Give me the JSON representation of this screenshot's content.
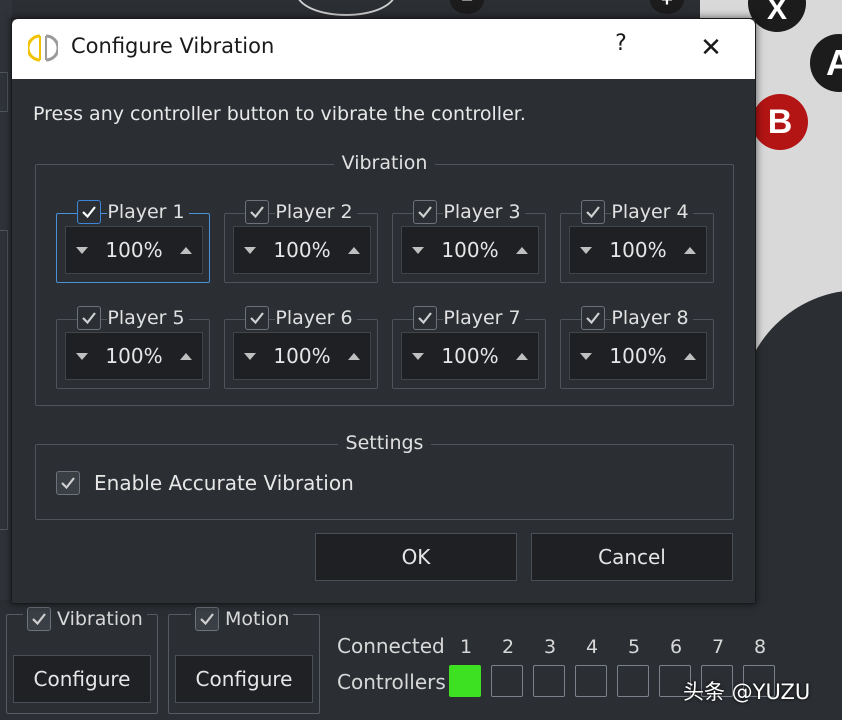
{
  "dialog": {
    "title": "Configure Vibration",
    "help_glyph": "?",
    "close_glyph": "✕",
    "instruction": "Press any controller button to vibrate the controller.",
    "vibration_group_title": "Vibration",
    "players": [
      {
        "label": "Player 1",
        "value": "100%"
      },
      {
        "label": "Player 2",
        "value": "100%"
      },
      {
        "label": "Player 3",
        "value": "100%"
      },
      {
        "label": "Player 4",
        "value": "100%"
      },
      {
        "label": "Player 5",
        "value": "100%"
      },
      {
        "label": "Player 6",
        "value": "100%"
      },
      {
        "label": "Player 7",
        "value": "100%"
      },
      {
        "label": "Player 8",
        "value": "100%"
      }
    ],
    "settings_group_title": "Settings",
    "accurate_vibration_label": "Enable Accurate Vibration",
    "ok_label": "OK",
    "cancel_label": "Cancel"
  },
  "background": {
    "buttons": {
      "x": "X",
      "a": "A",
      "b": "B",
      "minus": "−",
      "plus": "+"
    },
    "vibration_label": "Vibration",
    "vibration_configure": "Configure",
    "motion_label": "Motion",
    "motion_configure": "Configure",
    "connected_label": "Connected",
    "controllers_label": "Controllers",
    "controller_numbers": [
      "1",
      "2",
      "3",
      "4",
      "5",
      "6",
      "7",
      "8"
    ],
    "watermark": "头条 @YUZU"
  },
  "colors": {
    "accent_blue": "#3b86d6",
    "connected_green": "#3ee022",
    "button_b_red": "#b31414"
  }
}
